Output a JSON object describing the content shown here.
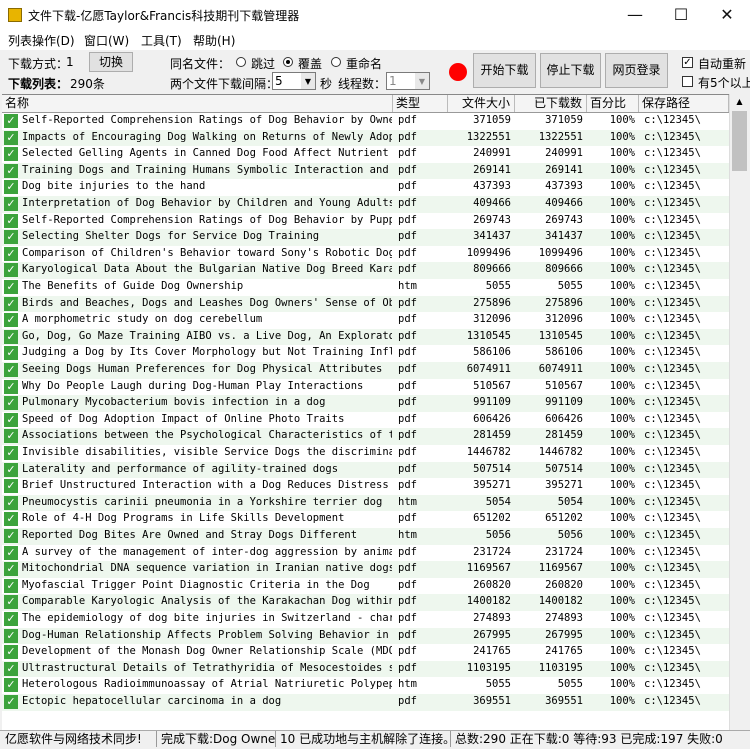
{
  "window": {
    "title": "文件下载-亿愿Taylor&Francis科技期刊下载管理器",
    "minimize": "—",
    "maximize": "☐",
    "close": "✕"
  },
  "menu": [
    "列表操作(D)",
    "窗口(W)",
    "工具(T)",
    "帮助(H)"
  ],
  "toolbar": {
    "download_mode_label": "下载方式：",
    "download_mode_value": "1",
    "switch_button": "切换",
    "list_label": "下载列表：",
    "list_count": "290条",
    "same_name_label": "同名文件：",
    "options": [
      {
        "label": "跳过",
        "selected": false
      },
      {
        "label": "覆盖",
        "selected": true
      },
      {
        "label": "重命名",
        "selected": false
      }
    ],
    "interval_label": "两个文件下载间隔：",
    "interval_value": "5",
    "seconds_label": "秒",
    "threads_label": "线程数：",
    "threads_value": "1",
    "start_button": "开始下载",
    "stop_button": "停止下载",
    "login_button": "网页登录",
    "auto_resume_label": "自动重新",
    "auto_resume_checked": true,
    "five_plus_label": "有5个以上",
    "five_plus_checked": false,
    "record_color": "#ff0000"
  },
  "grid": {
    "columns": [
      "名称",
      "类型",
      "文件大小",
      "已下载数",
      "百分比",
      "保存路径"
    ],
    "rows": [
      [
        "Self-Reported Comprehension Ratings of Dog Behavior by Owner...",
        "pdf",
        "371059",
        "371059",
        "100%",
        "c:\\12345\\"
      ],
      [
        "Impacts of Encouraging Dog Walking on Returns of Newly Adopt...",
        "pdf",
        "1322551",
        "1322551",
        "100%",
        "c:\\12345\\"
      ],
      [
        "Selected Gelling Agents in Canned Dog Food Affect Nutrient D...",
        "pdf",
        "240991",
        "240991",
        "100%",
        "c:\\12345\\"
      ],
      [
        "Training Dogs and Training Humans Symbolic Interaction and D...",
        "pdf",
        "269141",
        "269141",
        "100%",
        "c:\\12345\\"
      ],
      [
        "Dog bite injuries to the hand",
        "pdf",
        "437393",
        "437393",
        "100%",
        "c:\\12345\\"
      ],
      [
        "Interpretation of Dog Behavior by Children and Young Adults",
        "pdf",
        "409466",
        "409466",
        "100%",
        "c:\\12345\\"
      ],
      [
        "Self-Reported Comprehension Ratings of Dog Behavior by Puppy...",
        "pdf",
        "269743",
        "269743",
        "100%",
        "c:\\12345\\"
      ],
      [
        "Selecting Shelter Dogs for Service Dog Training",
        "pdf",
        "341437",
        "341437",
        "100%",
        "c:\\12345\\"
      ],
      [
        "Comparison of Children's Behavior toward Sony's Robotic Dog ...",
        "pdf",
        "1099496",
        "1099496",
        "100%",
        "c:\\12345\\"
      ],
      [
        "Karyological Data About the Bulgarian Native Dog Breed Karak...",
        "pdf",
        "809666",
        "809666",
        "100%",
        "c:\\12345\\"
      ],
      [
        "The Benefits of Guide Dog Ownership",
        "htm",
        "5055",
        "5055",
        "100%",
        "c:\\12345\\"
      ],
      [
        "Birds and Beaches, Dogs and Leashes Dog Owners' Sense of Obl...",
        "pdf",
        "275896",
        "275896",
        "100%",
        "c:\\12345\\"
      ],
      [
        "A morphometric study on dog cerebellum",
        "pdf",
        "312096",
        "312096",
        "100%",
        "c:\\12345\\"
      ],
      [
        "Go, Dog, Go Maze Training AIBO vs. a Live Dog, An Explorator...",
        "pdf",
        "1310545",
        "1310545",
        "100%",
        "c:\\12345\\"
      ],
      [
        "Judging a Dog by Its Cover Morphology but Not Training Influ...",
        "pdf",
        "586106",
        "586106",
        "100%",
        "c:\\12345\\"
      ],
      [
        "Seeing Dogs Human Preferences for Dog Physical Attributes",
        "pdf",
        "6074911",
        "6074911",
        "100%",
        "c:\\12345\\"
      ],
      [
        "Why Do People Laugh during Dog-Human Play Interactions",
        "pdf",
        "510567",
        "510567",
        "100%",
        "c:\\12345\\"
      ],
      [
        "Pulmonary Mycobacterium bovis infection in a dog",
        "pdf",
        "991109",
        "991109",
        "100%",
        "c:\\12345\\"
      ],
      [
        "Speed of Dog Adoption Impact of Online Photo Traits",
        "pdf",
        "606426",
        "606426",
        "100%",
        "c:\\12345\\"
      ],
      [
        "Associations between the Psychological Characteristics of th...",
        "pdf",
        "281459",
        "281459",
        "100%",
        "c:\\12345\\"
      ],
      [
        "Invisible disabilities, visible Service Dogs the discriminat...",
        "pdf",
        "1446782",
        "1446782",
        "100%",
        "c:\\12345\\"
      ],
      [
        "Laterality and performance of agility-trained dogs",
        "pdf",
        "507514",
        "507514",
        "100%",
        "c:\\12345\\"
      ],
      [
        "Brief Unstructured Interaction with a Dog Reduces Distress",
        "pdf",
        "395271",
        "395271",
        "100%",
        "c:\\12345\\"
      ],
      [
        "Pneumocystis carinii pneumonia in a Yorkshire terrier dog",
        "htm",
        "5054",
        "5054",
        "100%",
        "c:\\12345\\"
      ],
      [
        "Role of 4-H Dog Programs in Life Skills Development",
        "pdf",
        "651202",
        "651202",
        "100%",
        "c:\\12345\\"
      ],
      [
        "Reported Dog Bites Are Owned and Stray Dogs Different",
        "htm",
        "5056",
        "5056",
        "100%",
        "c:\\12345\\"
      ],
      [
        "A survey of the management of inter-dog aggression by animal...",
        "pdf",
        "231724",
        "231724",
        "100%",
        "c:\\12345\\"
      ],
      [
        "Mitochondrial DNA sequence variation in Iranian native dogs",
        "pdf",
        "1169567",
        "1169567",
        "100%",
        "c:\\12345\\"
      ],
      [
        "Myofascial Trigger Point Diagnostic Criteria in the Dog",
        "pdf",
        "260820",
        "260820",
        "100%",
        "c:\\12345\\"
      ],
      [
        "Comparable Karyologic Analysis of the Karakachan Dog within ...",
        "pdf",
        "1400182",
        "1400182",
        "100%",
        "c:\\12345\\"
      ],
      [
        "The epidemiology of dog bite injuries in Switzerland - char...",
        "pdf",
        "274893",
        "274893",
        "100%",
        "c:\\12345\\"
      ],
      [
        "Dog-Human Relationship Affects Problem Solving Behavior in t...",
        "pdf",
        "267995",
        "267995",
        "100%",
        "c:\\12345\\"
      ],
      [
        "Development of the Monash Dog Owner Relationship Scale (MDORS)",
        "pdf",
        "241765",
        "241765",
        "100%",
        "c:\\12345\\"
      ],
      [
        "Ultrastructural Details of Tetrathyridia of Mesocestoides sp...",
        "pdf",
        "1103195",
        "1103195",
        "100%",
        "c:\\12345\\"
      ],
      [
        "Heterologous Radioimmunoassay of Atrial Natriuretic Polypept...",
        "htm",
        "5055",
        "5055",
        "100%",
        "c:\\12345\\"
      ],
      [
        "Ectopic hepatocellular carcinoma in a dog",
        "pdf",
        "369551",
        "369551",
        "100%",
        "c:\\12345\\"
      ]
    ]
  },
  "status": {
    "brand": "亿愿软件与网络技术同步!",
    "completed": "完成下载:Dog Owners",
    "message": "10 已成功地与主机解除了连接。",
    "summary": "总数:290 正在下载:0 等待:93 已完成:197 失败:0"
  }
}
